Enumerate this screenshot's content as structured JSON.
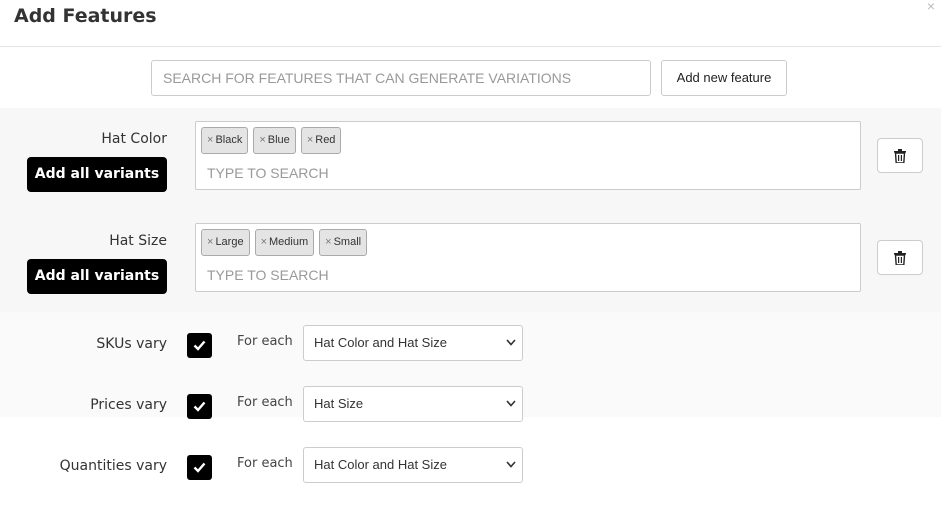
{
  "header": {
    "title": "Add Features",
    "close_symbol": "×"
  },
  "search": {
    "placeholder": "SEARCH FOR FEATURES THAT CAN GENERATE VARIATIONS",
    "add_button": "Add new feature"
  },
  "features": [
    {
      "label": "Hat Color",
      "add_all": "Add all variants",
      "tags": [
        "Black",
        "Blue",
        "Red"
      ],
      "input_placeholder": "TYPE TO SEARCH",
      "remove_symbol": "×"
    },
    {
      "label": "Hat Size",
      "add_all": "Add all variants",
      "tags": [
        "Large",
        "Medium",
        "Small"
      ],
      "input_placeholder": "TYPE TO SEARCH",
      "remove_symbol": "×"
    }
  ],
  "vary": [
    {
      "label": "SKUs vary",
      "checked": true,
      "for_each": "For each",
      "selected": "Hat Color and Hat Size"
    },
    {
      "label": "Prices vary",
      "checked": true,
      "for_each": "For each",
      "selected": "Hat Size"
    },
    {
      "label": "Quantities vary",
      "checked": true,
      "for_each": "For each",
      "selected": "Hat Color and Hat Size"
    }
  ],
  "icons": {
    "trash": "trash-icon",
    "check": "check-icon",
    "chevron": "chevron-down-icon",
    "close": "close-icon"
  }
}
